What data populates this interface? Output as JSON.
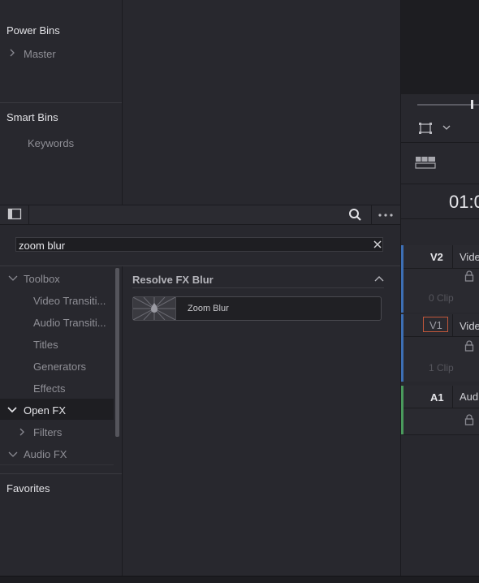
{
  "bins": {
    "power_bins_title": "Power Bins",
    "master_label": "Master",
    "smart_bins_title": "Smart Bins",
    "keywords_label": "Keywords"
  },
  "effects_library": {
    "search_value": "zoom blur",
    "tree": {
      "toolbox": "Toolbox",
      "video_transitions": "Video Transiti...",
      "audio_transitions": "Audio Transiti...",
      "titles": "Titles",
      "generators": "Generators",
      "effects": "Effects",
      "open_fx": "Open FX",
      "filters": "Filters",
      "audio_fx": "Audio FX",
      "favorites": "Favorites"
    },
    "results": {
      "group_title": "Resolve FX Blur",
      "items": [
        {
          "label": "Zoom Blur"
        }
      ]
    }
  },
  "timeline": {
    "timecode_partial": "01:0",
    "tracks": [
      {
        "id": "V2",
        "name": "Vide",
        "clips": "0 Clip",
        "color": "#3d6fb5"
      },
      {
        "id": "V1",
        "name": "Vide",
        "clips": "1 Clip",
        "color": "#3d6fb5"
      },
      {
        "id": "A1",
        "name": "Aud",
        "clips": "",
        "color": "#4a9a5c"
      }
    ]
  },
  "colors": {
    "bg": "#28282e",
    "selected_row": "#1e1e22",
    "v1_outline": "#c0563a"
  }
}
